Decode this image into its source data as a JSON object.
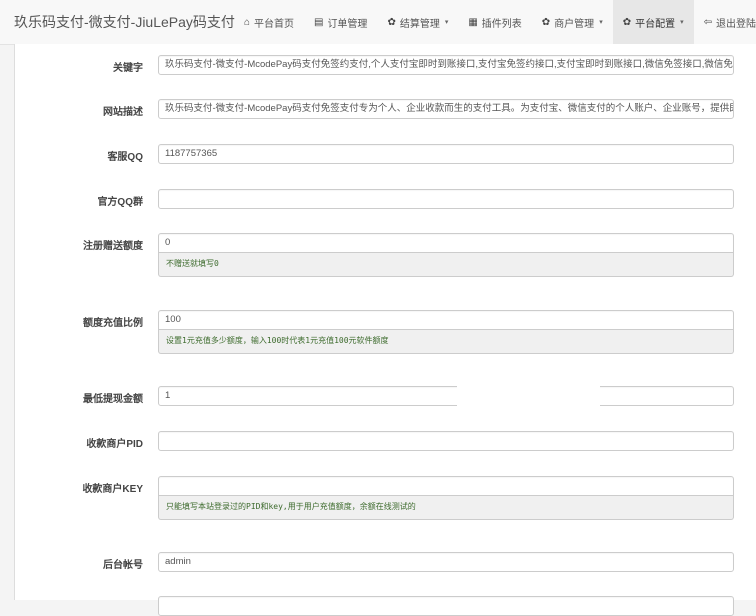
{
  "brand": "玖乐码支付-微支付-JiuLePay码支付",
  "nav": [
    {
      "icon": "⌂",
      "label": "平台首页",
      "caret": ""
    },
    {
      "icon": "▤",
      "label": "订单管理",
      "caret": ""
    },
    {
      "icon": "✿",
      "label": "结算管理",
      "caret": "▾"
    },
    {
      "icon": "▦",
      "label": "插件列表",
      "caret": ""
    },
    {
      "icon": "✿",
      "label": "商户管理",
      "caret": "▾"
    },
    {
      "icon": "✿",
      "label": "平台配置",
      "caret": "▾"
    },
    {
      "icon": "⇦",
      "label": "退出登陆",
      "caret": ""
    }
  ],
  "form": {
    "keywords": {
      "label": "关键字",
      "value": "玖乐码支付-微支付-McodePay码支付免签约支付,个人支付宝即时到账接口,支付宝免签约接口,支付宝即时到账接口,微信免签接口,微信免签,支"
    },
    "description": {
      "label": "网站描述",
      "value": "玖乐码支付-微支付-McodePay码支付免签支付专为个人、企业收款而生的支付工具。为支付宝、微信支付的个人账户、企业账号，提供即时到"
    },
    "qq": {
      "label": "客服QQ",
      "value": "1187757365"
    },
    "qq_group": {
      "label": "官方QQ群",
      "value": ""
    },
    "register_bonus": {
      "label": "注册赠送额度",
      "value": "0",
      "help": "不赠送就填写0"
    },
    "recharge_ratio": {
      "label": "额度充值比例",
      "value": "100",
      "help": "设置1元充值多少额度，输入100时代表1元充值100元软件额度"
    },
    "min_withdraw": {
      "label": "最低提现金额",
      "value": "1"
    },
    "merchant_pid": {
      "label": "收款商户PID",
      "value": ""
    },
    "merchant_key": {
      "label": "收款商户KEY",
      "value": "",
      "help": "只能填写本站登录过的PID和key,用于用户充值额度，余额在线测试的"
    },
    "admin_account": {
      "label": "后台帐号",
      "value": "admin"
    }
  }
}
